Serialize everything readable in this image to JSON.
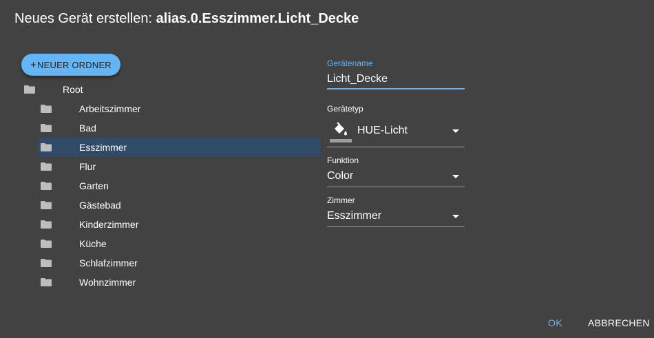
{
  "dialog": {
    "title_prefix": "Neues Gerät erstellen: ",
    "title_path": "alias.0.Esszimmer.Licht_Decke"
  },
  "tree": {
    "new_folder_label": "NEUER ORDNER",
    "root_label": "Root",
    "selected": "Esszimmer",
    "items": [
      {
        "label": "Arbeitszimmer"
      },
      {
        "label": "Bad"
      },
      {
        "label": "Esszimmer"
      },
      {
        "label": "Flur"
      },
      {
        "label": "Garten"
      },
      {
        "label": "Gästebad"
      },
      {
        "label": "Kinderzimmer"
      },
      {
        "label": "Küche"
      },
      {
        "label": "Schlafzimmer"
      },
      {
        "label": "Wohnzimmer"
      }
    ]
  },
  "form": {
    "name_label": "Gerätename",
    "name_value": "Licht_Decke",
    "type_label": "Gerätetyp",
    "type_value": "HUE-Licht",
    "type_icon": "paint-bucket-icon",
    "function_label": "Funktion",
    "function_value": "Color",
    "room_label": "Zimmer",
    "room_value": "Esszimmer"
  },
  "footer": {
    "ok_label": "OK",
    "cancel_label": "ABBRECHEN"
  },
  "colors": {
    "background": "#424242",
    "accent": "#64b5f6",
    "selected_row": "#2f4b68",
    "folder_icon": "#bdbdbd"
  }
}
